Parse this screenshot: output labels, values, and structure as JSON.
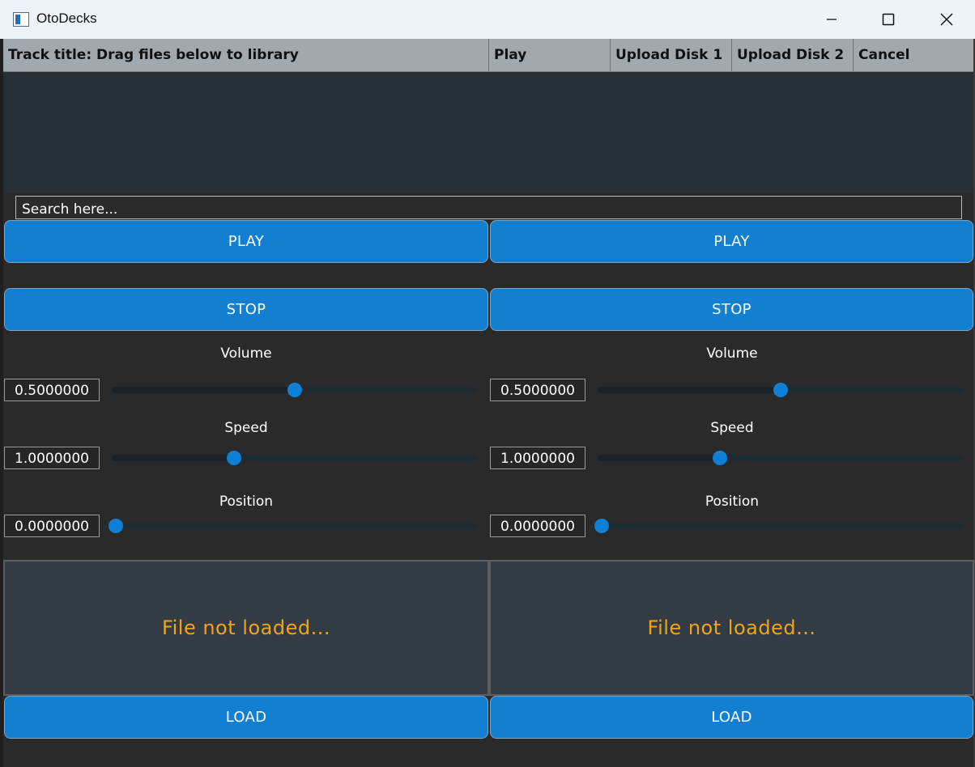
{
  "window": {
    "title": "OtoDecks",
    "icon": "app-window-icon",
    "controls": [
      "minimize-icon",
      "maximize-icon",
      "close-icon"
    ]
  },
  "library": {
    "columns": [
      "Track title: Drag files below to library",
      "Play",
      "Upload Disk 1",
      "Upload Disk 2",
      "Cancel"
    ],
    "search_placeholder": "Search here..."
  },
  "decks": [
    {
      "play_label": "PLAY",
      "stop_label": "STOP",
      "volume": {
        "label": "Volume",
        "value": "0.5000000",
        "fraction": 0.5
      },
      "speed": {
        "label": "Speed",
        "value": "1.0000000",
        "fraction": 0.335
      },
      "position": {
        "label": "Position",
        "value": "0.0000000",
        "fraction": 0.0
      },
      "waveform_text": "File not loaded...",
      "load_label": "LOAD"
    },
    {
      "play_label": "PLAY",
      "stop_label": "STOP",
      "volume": {
        "label": "Volume",
        "value": "0.5000000",
        "fraction": 0.5
      },
      "speed": {
        "label": "Speed",
        "value": "1.0000000",
        "fraction": 0.335
      },
      "position": {
        "label": "Position",
        "value": "0.0000000",
        "fraction": 0.0
      },
      "waveform_text": "File not loaded...",
      "load_label": "LOAD"
    }
  ],
  "colors": {
    "accent": "#127fd0",
    "status_text": "#f0a418",
    "header_bg": "#a3a8ad",
    "window_bg": "#2a2a2a"
  }
}
